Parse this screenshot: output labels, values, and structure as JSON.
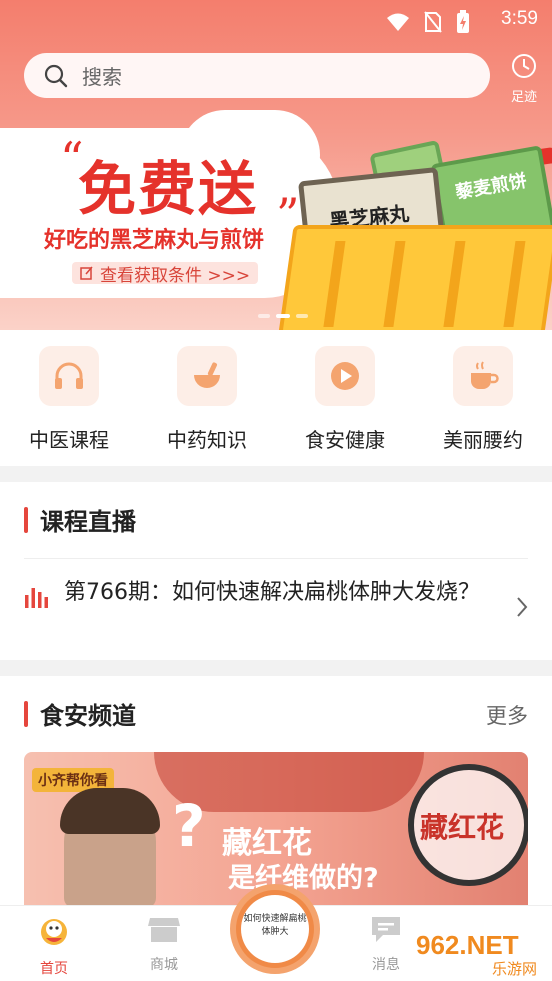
{
  "status_bar": {
    "time": "3:59"
  },
  "search": {
    "placeholder": "搜索"
  },
  "footprint": {
    "label": "足迹"
  },
  "banner": {
    "title": "免费送",
    "quote_open": "“",
    "quote_close": "”",
    "subtitle": "好吃的黑芝麻丸与煎饼",
    "link": "查看获取条件 >>>",
    "pack1_name": "黑芝麻丸",
    "pack2_name": "藜麦煎饼",
    "pages": 3,
    "active_page": 2
  },
  "categories": [
    {
      "label": "中医课程",
      "icon": "headphones-icon"
    },
    {
      "label": "中药知识",
      "icon": "mortar-icon"
    },
    {
      "label": "食安健康",
      "icon": "play-icon"
    },
    {
      "label": "美丽腰约",
      "icon": "coffee-cup-icon"
    }
  ],
  "live": {
    "title": "课程直播",
    "item": "第766期：如何快速解决扁桃体肿大发烧？"
  },
  "food": {
    "title": "食安频道",
    "more": "更多",
    "card": {
      "badge": "小齐帮你看",
      "line1": "藏红花",
      "line2": "是纤维做的?",
      "lens_text": "藏红花"
    }
  },
  "tabbar": {
    "items": [
      {
        "label": "首页",
        "active": true
      },
      {
        "label": "商城",
        "active": false
      },
      {
        "label": "消息",
        "active": false
      }
    ],
    "center_text": "如何快速解扁桃体肿大"
  },
  "watermark": {
    "brand": "962.NET",
    "site": "乐游网"
  },
  "colors": {
    "accent": "#e5463d",
    "banner_red": "#e5322b"
  }
}
